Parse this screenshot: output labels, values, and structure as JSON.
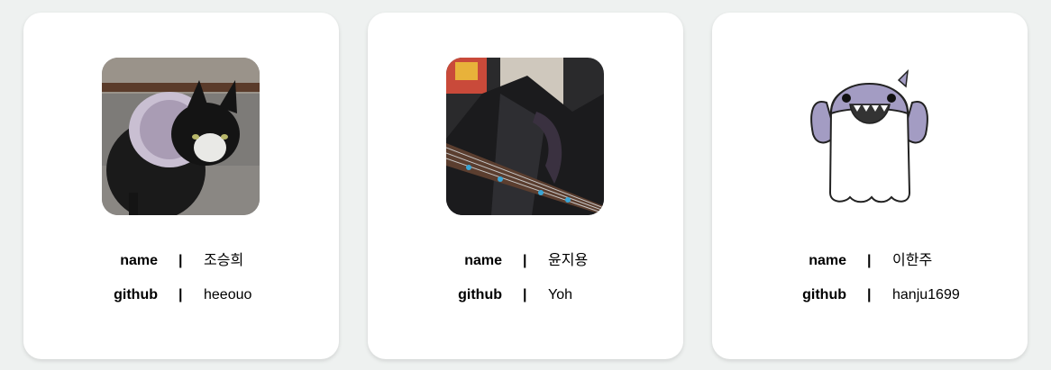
{
  "members": [
    {
      "name_label": "name",
      "name": "조승희",
      "github_label": "github",
      "github": "heeouo",
      "separator": "|",
      "avatar_icon": "cat-photo"
    },
    {
      "name_label": "name",
      "name": "윤지용",
      "github_label": "github",
      "github": "Yoh",
      "separator": "|",
      "avatar_icon": "bass-guitar-photo"
    },
    {
      "name_label": "name",
      "name": "이한주",
      "github_label": "github",
      "github": "hanju1699",
      "separator": "|",
      "avatar_icon": "shark-character-icon"
    }
  ],
  "colors": {
    "background": "#eef1f0",
    "card": "#ffffff",
    "text": "#111111"
  }
}
